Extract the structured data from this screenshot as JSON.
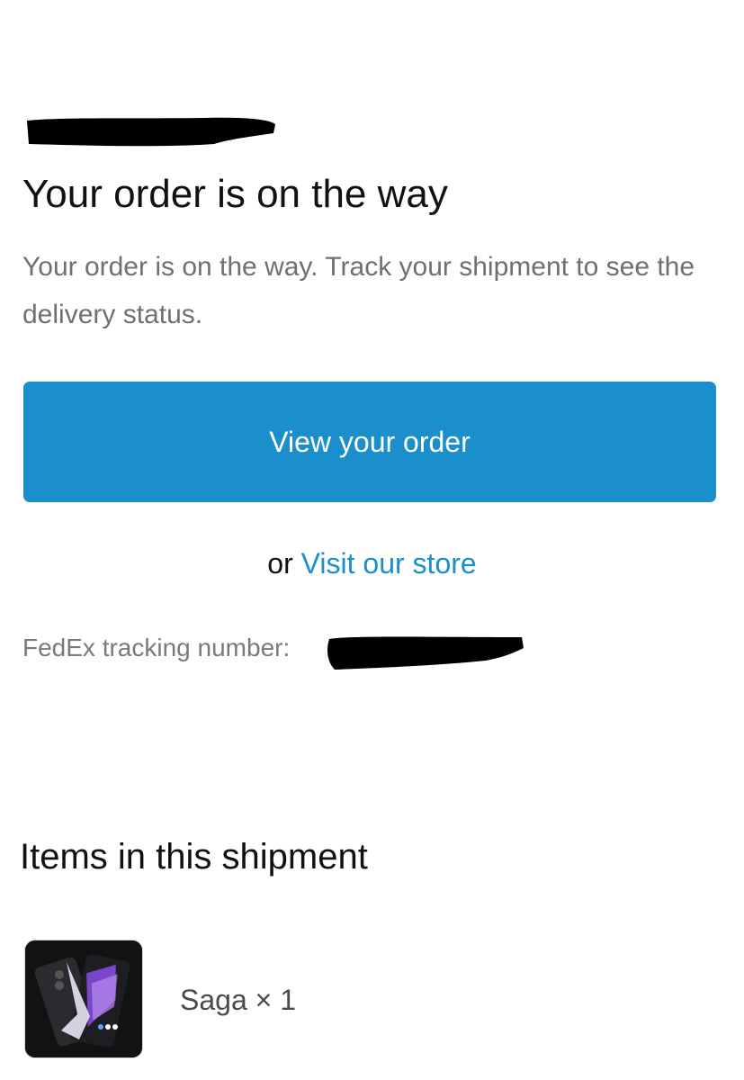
{
  "header": {
    "title": "Your order is on the way",
    "subtitle": "Your order is on the way. Track your shipment to see the delivery status."
  },
  "actions": {
    "view_order_label": "View your order",
    "or_text": "or",
    "visit_store_label": "Visit our store"
  },
  "tracking": {
    "label": "FedEx tracking number:"
  },
  "shipment": {
    "section_title": "Items in this shipment",
    "items": [
      {
        "name": "Saga × 1",
        "image_icon": "phone-product-icon"
      }
    ]
  },
  "colors": {
    "accent": "#1a8fcb",
    "text_primary": "#111111",
    "text_secondary": "#707070",
    "redaction": "#000000"
  }
}
